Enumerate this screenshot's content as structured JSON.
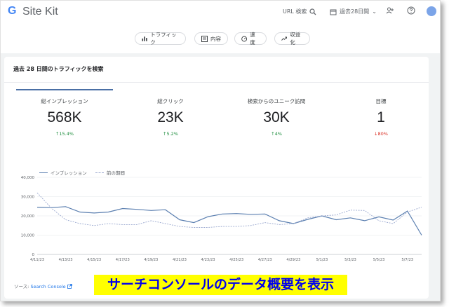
{
  "app": {
    "logo": "G",
    "brand": "Site Kit"
  },
  "topbar": {
    "url_search_label": "URL 検索",
    "date_range_label": "過去28日間",
    "dropdown_arrow": "⌄"
  },
  "nav": {
    "tabs": [
      {
        "label": "トラフィック"
      },
      {
        "label": "内容"
      },
      {
        "label": "速度"
      },
      {
        "label": "収益化"
      }
    ]
  },
  "card": {
    "title": "過去 28 日間のトラフィックを検索"
  },
  "metrics": [
    {
      "label": "総インプレッション",
      "value": "568K",
      "change": "15.4%",
      "direction": "up"
    },
    {
      "label": "総クリック",
      "value": "23K",
      "change": "5.2%",
      "direction": "up"
    },
    {
      "label": "検索からのユニーク訪問",
      "value": "30K",
      "change": "4%",
      "direction": "up"
    },
    {
      "label": "目標",
      "value": "1",
      "change": "80%",
      "direction": "down"
    }
  ],
  "chart_data": {
    "type": "line",
    "x": [
      "4/11/23",
      "4/12/23",
      "4/13/23",
      "4/14/23",
      "4/15/23",
      "4/16/23",
      "4/17/23",
      "4/18/23",
      "4/19/23",
      "4/20/23",
      "4/21/23",
      "4/22/23",
      "4/23/23",
      "4/24/23",
      "4/25/23",
      "4/26/23",
      "4/27/23",
      "4/28/23",
      "4/29/23",
      "4/30/23",
      "5/1/23",
      "5/2/23",
      "5/3/23",
      "5/4/23",
      "5/5/23",
      "5/6/23",
      "5/7/23",
      "5/8/23"
    ],
    "tick_labels": [
      "4/11/23",
      "4/13/23",
      "4/15/23",
      "4/17/23",
      "4/19/23",
      "4/21/23",
      "4/23/23",
      "4/25/23",
      "4/27/23",
      "4/29/23",
      "5/1/23",
      "5/3/23",
      "5/5/23",
      "5/7/23"
    ],
    "series": [
      {
        "name": "インプレッション",
        "style": "solid",
        "color": "#5b7fb0",
        "values": [
          24500,
          24300,
          24800,
          22000,
          21500,
          22000,
          23800,
          23400,
          22800,
          23200,
          18000,
          16500,
          19600,
          21000,
          21200,
          20800,
          21000,
          17500,
          16000,
          18200,
          20000,
          18000,
          19000,
          17500,
          19500,
          17800,
          22500,
          10000
        ]
      },
      {
        "name": "前の期間",
        "style": "dashed",
        "color": "#9aa8cf",
        "values": [
          32000,
          24000,
          18000,
          16000,
          15000,
          16000,
          15500,
          15500,
          17500,
          16000,
          14500,
          14000,
          14000,
          14500,
          14500,
          15000,
          16500,
          15500,
          16000,
          19000,
          20000,
          20500,
          23000,
          22800,
          17500,
          16000,
          22000,
          24500
        ]
      }
    ],
    "ylim": [
      0,
      40000
    ],
    "yticks": [
      "0",
      "10,000",
      "20,000",
      "30,000",
      "40,000"
    ],
    "grid": true,
    "legend": "top-left"
  },
  "footer": {
    "source_label": "ソース: ",
    "source_link": "Search Console"
  },
  "banner": {
    "text": "サーチコンソールのデータ概要を表示"
  }
}
